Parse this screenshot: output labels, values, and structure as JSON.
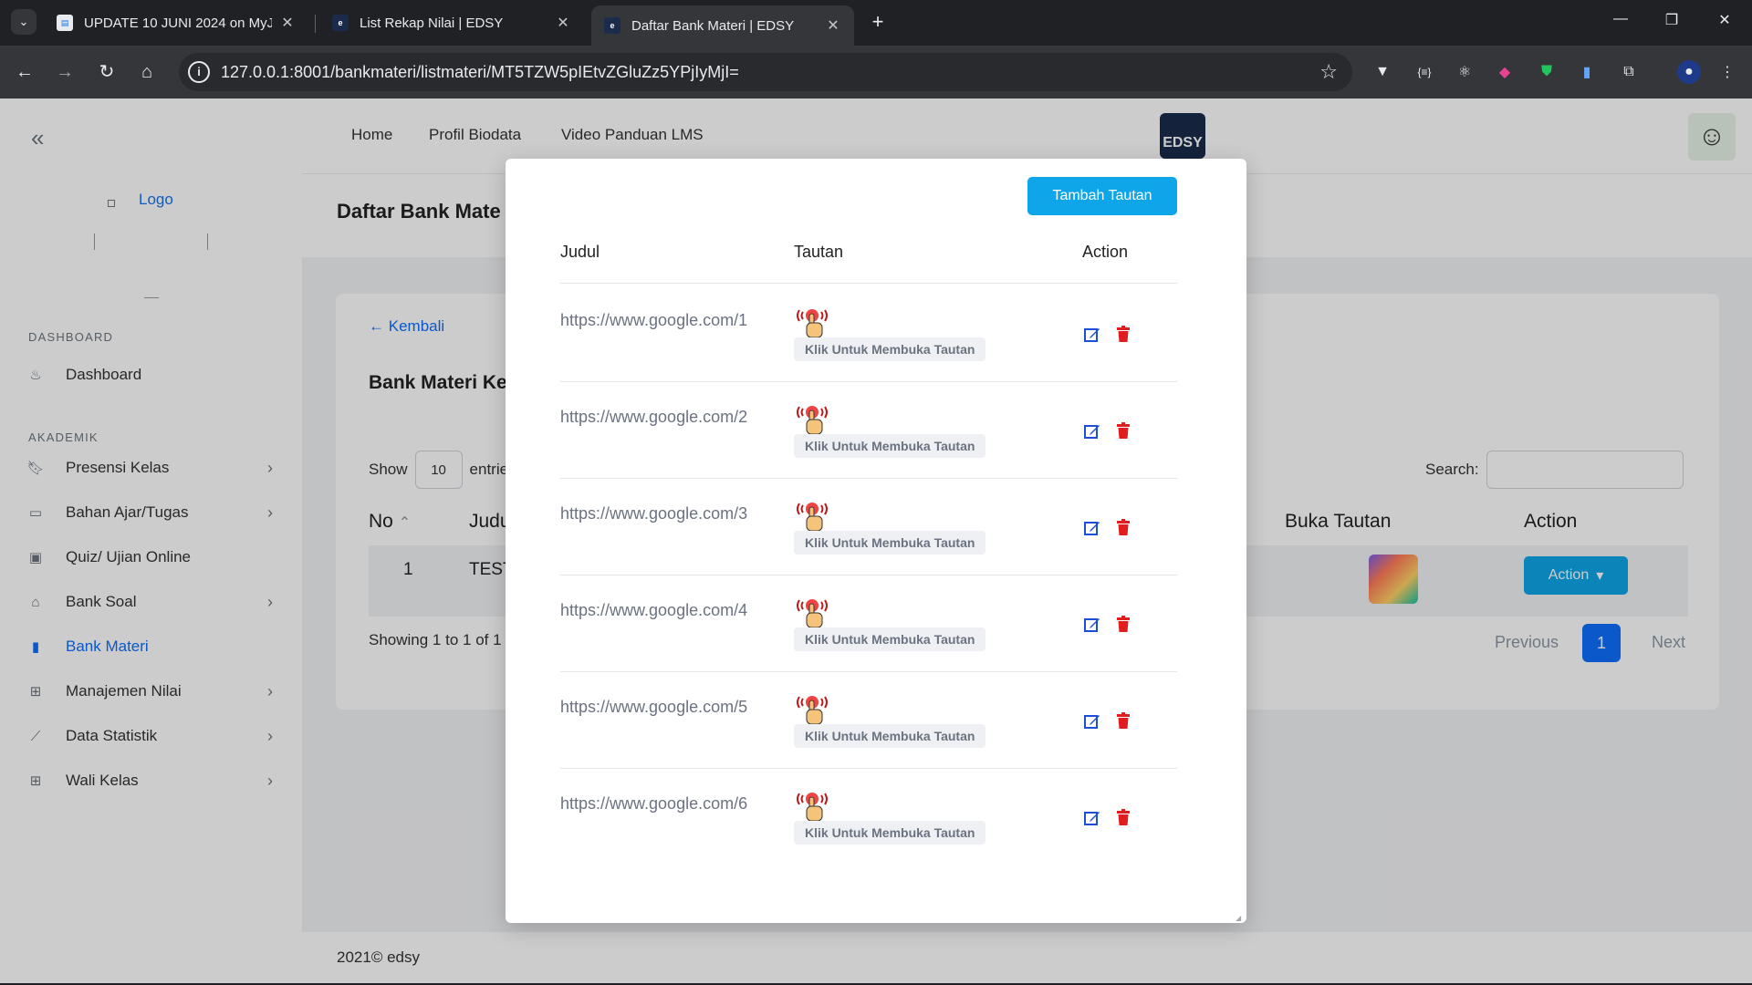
{
  "browser": {
    "tabs": [
      {
        "title": "UPDATE 10 JUNI 2024 on MyJo",
        "active": false
      },
      {
        "title": "List Rekap Nilai | EDSY",
        "active": false
      },
      {
        "title": "Daftar Bank Materi | EDSY",
        "active": true
      }
    ],
    "url": "127.0.0.1:8001/bankmateri/listmateri/MT5TZW5pIEtvZGluZz5YPjIyMjI="
  },
  "sidebar": {
    "logo_text": "Logo",
    "sections": [
      {
        "title": "DASHBOARD"
      },
      {
        "title": "AKADEMIK"
      }
    ],
    "items": [
      {
        "label": "Dashboard",
        "icon": "fire-icon"
      },
      {
        "label": "Presensi Kelas",
        "icon": "bookmark-icon"
      },
      {
        "label": "Bahan Ajar/Tugas",
        "icon": "inbox-icon"
      },
      {
        "label": "Quiz/ Ujian Online",
        "icon": "calendar-icon"
      },
      {
        "label": "Bank Soal",
        "icon": "bank-icon"
      },
      {
        "label": "Bank Materi",
        "icon": "book-icon",
        "active": true
      },
      {
        "label": "Manajemen Nilai",
        "icon": "plus-square-icon"
      },
      {
        "label": "Data Statistik",
        "icon": "chart-icon"
      },
      {
        "label": "Wali Kelas",
        "icon": "grid-icon"
      }
    ]
  },
  "topnav": {
    "links": [
      "Home",
      "Profil Biodata",
      "Video Panduan LMS"
    ],
    "brand": "EDSY"
  },
  "page": {
    "title": "Daftar Bank Mate",
    "back": "Kembali",
    "card_title": "Bank Materi Ke",
    "show_label": "Show",
    "entries_value": "10",
    "entries_label": "entrie",
    "search_label": "Search:",
    "columns": {
      "no": "No",
      "judul": "Judu",
      "buka": "Buka Tautan",
      "action": "Action"
    },
    "row": {
      "no": "1",
      "judul": "TEST",
      "action": "Action"
    },
    "showing": "Showing 1 to 1 of 1 e",
    "pagination": {
      "previous": "Previous",
      "page": "1",
      "next": "Next"
    }
  },
  "footer": {
    "text": "2021©  edsy"
  },
  "modal": {
    "add_button": "Tambah Tautan",
    "columns": {
      "judul": "Judul",
      "tautan": "Tautan",
      "action": "Action"
    },
    "badge_text": "Klik Untuk Membuka Tautan",
    "rows": [
      {
        "judul": "https://www.google.com/1"
      },
      {
        "judul": "https://www.google.com/2"
      },
      {
        "judul": "https://www.google.com/3"
      },
      {
        "judul": "https://www.google.com/4"
      },
      {
        "judul": "https://www.google.com/5"
      },
      {
        "judul": "https://www.google.com/6"
      }
    ]
  },
  "colors": {
    "primary": "#0d6efd",
    "button": "#0ea5e9",
    "danger": "#e11d1d",
    "edit": "#1d4ed8"
  }
}
